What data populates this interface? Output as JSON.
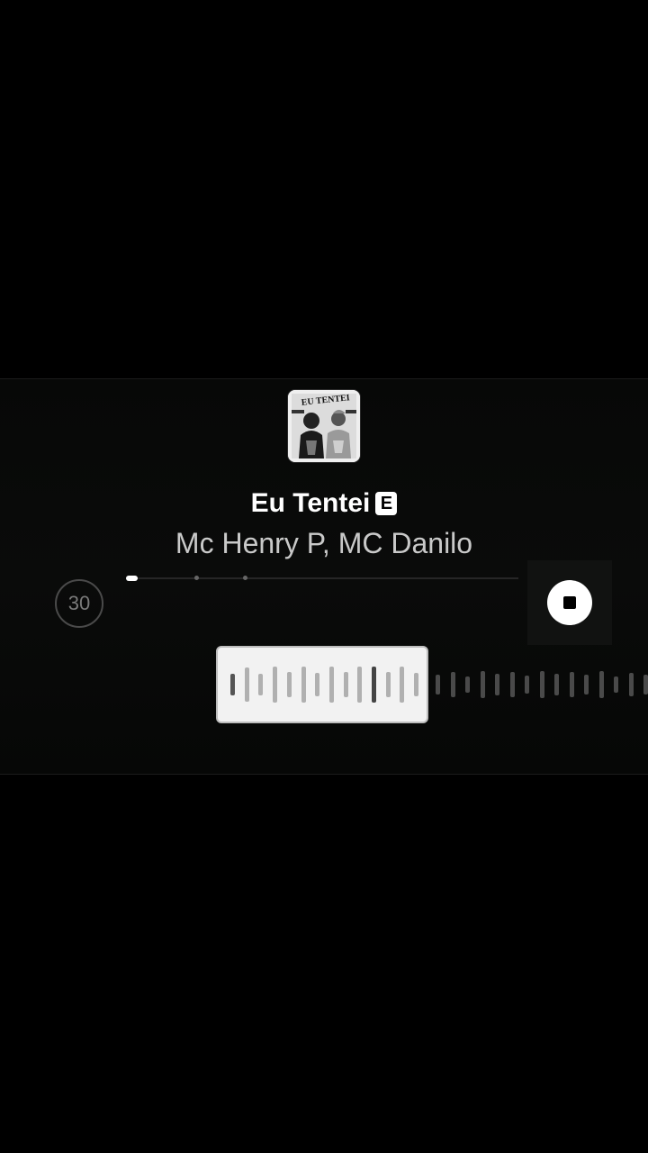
{
  "track": {
    "title": "Eu Tentei",
    "explicit_label": "E",
    "artist": "Mc Henry P, MC Danilo",
    "album_art_text": "EU TENTEI"
  },
  "player": {
    "duration_label": "30",
    "progress_fraction": 0.03
  },
  "colors": {
    "background": "#000000",
    "panel": "#090a09",
    "title": "#ffffff",
    "artist": "#c9c9c9"
  },
  "icons": {
    "stop": "stop-icon"
  }
}
